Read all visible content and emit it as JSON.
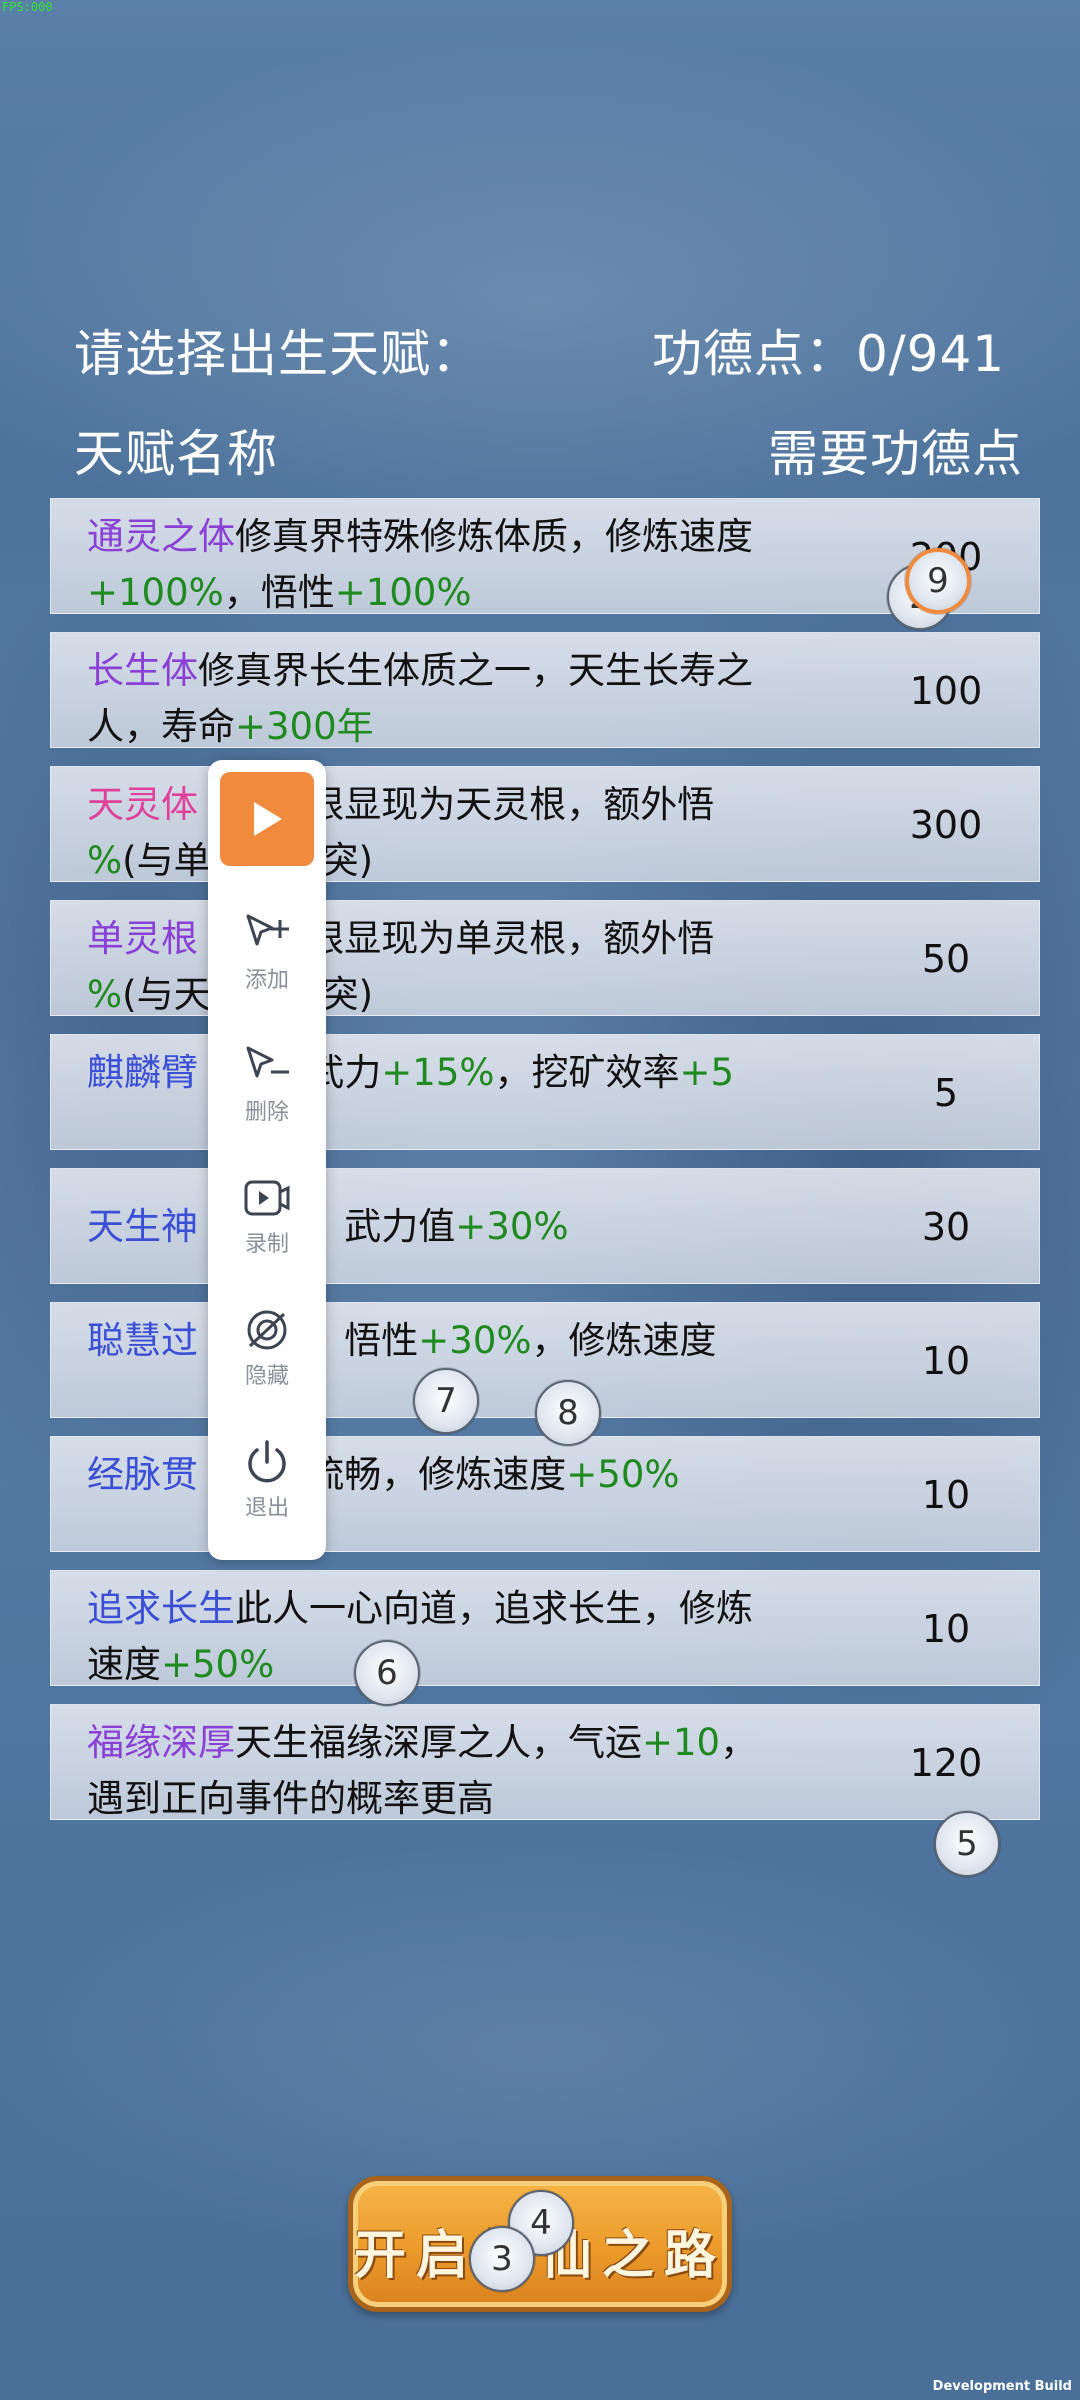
{
  "overlay": {
    "fps": "FPS:000",
    "dev_build": "Development Build"
  },
  "header": {
    "title": "请选择出生天赋：",
    "points": "功德点：0/941"
  },
  "columns": {
    "name": "天赋名称",
    "cost": "需要功德点"
  },
  "talents": [
    {
      "name": "通灵之体",
      "name_color": "#8a3fd6",
      "desc_a": "修真界特殊修炼体质，修炼速度",
      "bonus_a": "+100%",
      "desc_b": "，悟性",
      "bonus_b": "+100%",
      "desc_c": "",
      "cost": "200"
    },
    {
      "name": "长生体",
      "name_color": "#8a3fd6",
      "desc_a": "修真界长生体质之一，天生长寿之人，寿命",
      "bonus_a": "+300年",
      "desc_b": "",
      "bonus_b": "",
      "desc_c": "",
      "cost": "100"
    },
    {
      "name": "天灵体",
      "name_color": "#e0409a",
      "desc_a": "   时灵根显现为天灵根，额外悟",
      "bonus_a": "   %",
      "desc_b": "(与单灵根冲突)",
      "bonus_b": "",
      "desc_c": "",
      "cost": "300"
    },
    {
      "name": "单灵根",
      "name_color": "#8a3fd6",
      "desc_a": "   时灵根显现为单灵根，额外悟",
      "bonus_a": "   %",
      "desc_b": "(与天灵根冲突)",
      "bonus_b": "",
      "desc_c": "",
      "cost": "50"
    },
    {
      "name": "麒麟臂",
      "name_color": "#3b4fd6",
      "desc_a": "   人，武力",
      "bonus_a": "+15%",
      "desc_b": "，挖矿效率",
      "bonus_b": "+5",
      "desc_c": "",
      "cost": "5"
    },
    {
      "name": "天生神",
      "name_color": "#3b4fd6",
      "desc_a": "   神力，武力值",
      "bonus_a": "+30%",
      "desc_b": "",
      "bonus_b": "",
      "desc_c": "",
      "cost": "30",
      "single": true
    },
    {
      "name": "聪慧过",
      "name_color": "#3b4fd6",
      "desc_a": "   聪明，悟性",
      "bonus_a": "+30%",
      "desc_b": "，修炼速度",
      "bonus_b": "",
      "desc_c": "",
      "cost": "10"
    },
    {
      "name": "经脉贯",
      "name_color": "#3b4fd6",
      "desc_a": "   运行流畅，修炼速度",
      "bonus_a": "+50%",
      "desc_b": "",
      "bonus_b": "",
      "desc_c": "",
      "cost": "10"
    },
    {
      "name": "追求长生",
      "name_color": "#3b4fd6",
      "desc_a": "此人一心向道，追求长生，修炼速度",
      "bonus_a": "+50%",
      "desc_b": "",
      "bonus_b": "",
      "desc_c": "",
      "cost": "10"
    },
    {
      "name": "福缘深厚",
      "name_color": "#8a3fd6",
      "desc_a": "天生福缘深厚之人，气运",
      "bonus_a": "+10",
      "desc_b": "，遇到正向事件的概率更高",
      "bonus_b": "",
      "desc_c": "",
      "cost": "120"
    }
  ],
  "panel": {
    "add": "添加",
    "delete": "删除",
    "record": "录制",
    "hide": "隐藏",
    "exit": "退出"
  },
  "markers": {
    "m2": "2",
    "m3": "3",
    "m4": "4",
    "m5": "5",
    "m6": "6",
    "m7": "7",
    "m8": "8",
    "m9": "9"
  },
  "start_button": {
    "label": "开启修仙之路"
  },
  "colors": {
    "play_button": "#f08a3c",
    "bonus_green": "#1f8a1f",
    "button_orange": "#eb9a2a"
  }
}
